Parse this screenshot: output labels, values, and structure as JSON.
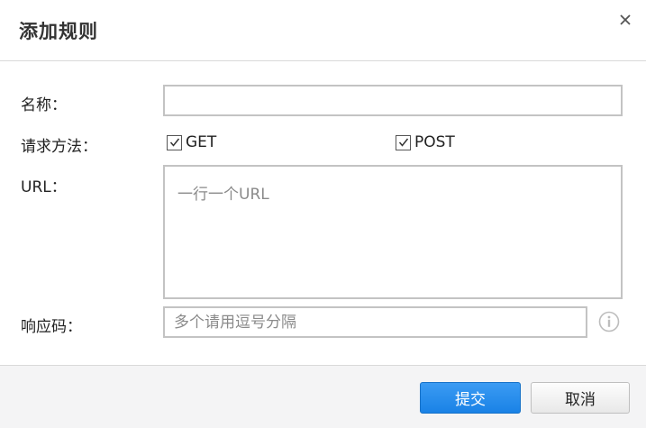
{
  "dialog": {
    "title": "添加规则",
    "close_icon": "close-icon"
  },
  "form": {
    "name": {
      "label": "名称：",
      "value": ""
    },
    "method": {
      "label": "请求方法：",
      "options": [
        {
          "label": "GET",
          "checked": true
        },
        {
          "label": "POST",
          "checked": true
        }
      ]
    },
    "url": {
      "label": "URL：",
      "placeholder": "一行一个URL",
      "value": ""
    },
    "status_code": {
      "label": "响应码：",
      "placeholder": "多个请用逗号分隔",
      "value": "",
      "info_icon": "info-icon"
    }
  },
  "footer": {
    "submit_label": "提交",
    "cancel_label": "取消",
    "submit_color": "#1a82e6"
  }
}
